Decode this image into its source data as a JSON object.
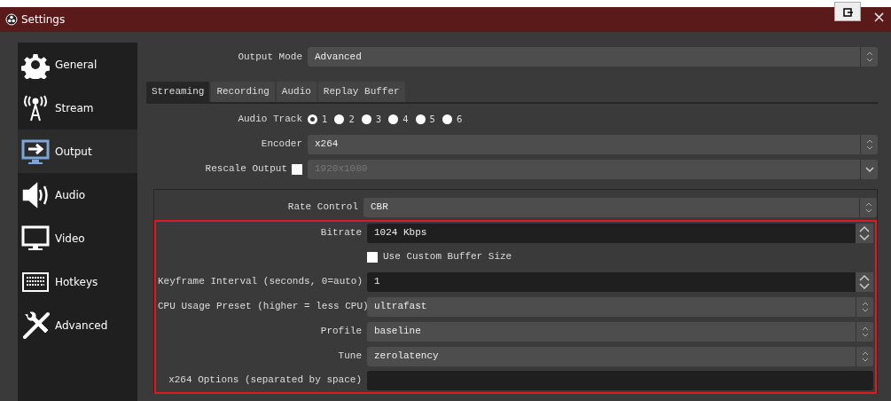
{
  "window": {
    "title": "Settings",
    "controls": [
      "×"
    ]
  },
  "sidebar": {
    "items": [
      {
        "label": "General",
        "selected": false
      },
      {
        "label": "Stream",
        "selected": false
      },
      {
        "label": "Output",
        "selected": true
      },
      {
        "label": "Audio",
        "selected": false
      },
      {
        "label": "Video",
        "selected": false
      },
      {
        "label": "Hotkeys",
        "selected": false
      },
      {
        "label": "Advanced",
        "selected": false
      }
    ]
  },
  "output_mode": {
    "label": "Output Mode",
    "value": "Advanced"
  },
  "tabs": [
    {
      "label": "Streaming",
      "selected": true
    },
    {
      "label": "Recording",
      "selected": false
    },
    {
      "label": "Audio",
      "selected": false
    },
    {
      "label": "Replay Buffer",
      "selected": false
    }
  ],
  "audio_track": {
    "label": "Audio Track",
    "options": [
      {
        "label": "1",
        "selected": true
      },
      {
        "label": "2",
        "selected": false
      },
      {
        "label": "3",
        "selected": false
      },
      {
        "label": "4",
        "selected": false
      },
      {
        "label": "5",
        "selected": false
      },
      {
        "label": "6",
        "selected": false
      }
    ]
  },
  "fields": [
    {
      "kind": "combo",
      "label": "Encoder",
      "value": "x264",
      "disabled": false
    },
    {
      "kind": "dropdown",
      "label": "Rescale Output",
      "value": "1920x1080",
      "checked": false,
      "disabled": true
    }
  ],
  "encoder_settings": [
    {
      "kind": "combo",
      "label": "Rate Control",
      "value": "CBR",
      "highlighted": false
    },
    {
      "kind": "spin",
      "label": "Bitrate",
      "value": "1024 Kbps",
      "highlighted": true
    },
    {
      "kind": "checkbox",
      "label": "Use Custom Buffer Size",
      "checked": false,
      "highlighted": true
    },
    {
      "kind": "spin",
      "label": "Keyframe Interval (seconds, 0=auto)",
      "value": "1",
      "highlighted": true
    },
    {
      "kind": "combo",
      "label": "CPU Usage Preset (higher = less CPU)",
      "value": "ultrafast",
      "highlighted": true
    },
    {
      "kind": "combo",
      "label": "Profile",
      "value": "baseline",
      "highlighted": true
    },
    {
      "kind": "combo",
      "label": "Tune",
      "value": "zerolatency",
      "highlighted": true
    },
    {
      "kind": "text",
      "label": "x264 Options (separated by space)",
      "highlighted": true
    }
  ]
}
